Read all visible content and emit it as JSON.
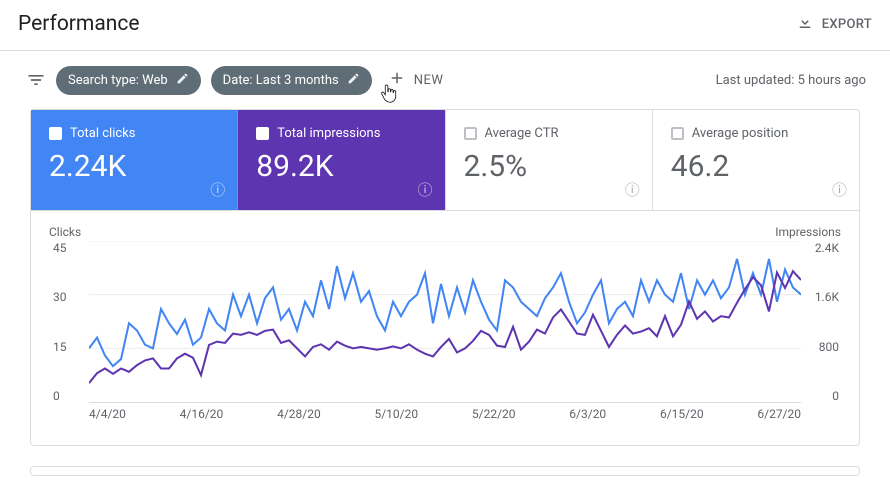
{
  "header": {
    "title": "Performance",
    "export_label": "EXPORT"
  },
  "filters": {
    "chips": [
      {
        "label": "Search type: Web"
      },
      {
        "label": "Date: Last 3 months"
      }
    ],
    "new_label": "NEW",
    "last_updated": "Last updated: 5 hours ago"
  },
  "metrics": [
    {
      "key": "total_clicks",
      "label": "Total clicks",
      "value": "2.24K",
      "checked": true,
      "variant": "blue"
    },
    {
      "key": "total_impressions",
      "label": "Total impressions",
      "value": "89.2K",
      "checked": true,
      "variant": "purple"
    },
    {
      "key": "avg_ctr",
      "label": "Average CTR",
      "value": "2.5%",
      "checked": false,
      "variant": "plain"
    },
    {
      "key": "avg_position",
      "label": "Average position",
      "value": "46.2",
      "checked": false,
      "variant": "plain"
    }
  ],
  "chart_data": {
    "type": "line",
    "left_axis_label": "Clicks",
    "right_axis_label": "Impressions",
    "left_ylim": [
      0,
      45
    ],
    "right_ylim": [
      0,
      2400
    ],
    "y_left_ticks": [
      "45",
      "30",
      "15",
      "0"
    ],
    "y_right_ticks": [
      "2.4K",
      "1.6K",
      "800",
      "0"
    ],
    "x_ticks": [
      "4/4/20",
      "4/16/20",
      "4/28/20",
      "5/10/20",
      "5/22/20",
      "6/3/20",
      "6/15/20",
      "6/27/20"
    ],
    "series": [
      {
        "name": "Clicks",
        "axis": "left",
        "color": "#4285f4",
        "values": [
          15,
          18,
          13,
          10,
          12,
          22,
          20,
          16,
          15,
          26,
          22,
          19,
          23,
          16,
          18,
          26,
          22,
          20,
          30,
          24,
          30,
          22,
          29,
          32,
          23,
          26,
          20,
          28,
          24,
          34,
          26,
          38,
          29,
          36,
          28,
          31,
          24,
          20,
          28,
          24,
          28,
          30,
          36,
          22,
          33,
          24,
          32,
          25,
          34,
          28,
          23,
          20,
          34,
          32,
          28,
          26,
          24,
          29,
          32,
          36,
          28,
          22,
          25,
          30,
          34,
          22,
          26,
          28,
          24,
          34,
          28,
          34,
          30,
          28,
          36,
          26,
          34,
          30,
          34,
          29,
          32,
          40,
          30,
          36,
          30,
          40,
          28,
          37,
          32,
          30
        ]
      },
      {
        "name": "Impressions",
        "axis": "right",
        "color": "#5e35b1",
        "values": [
          280,
          430,
          500,
          420,
          500,
          450,
          550,
          620,
          650,
          500,
          500,
          650,
          720,
          660,
          400,
          850,
          900,
          880,
          1020,
          1000,
          1040,
          1000,
          1060,
          1080,
          880,
          920,
          800,
          680,
          820,
          860,
          780,
          900,
          840,
          800,
          820,
          800,
          780,
          800,
          830,
          800,
          860,
          780,
          720,
          680,
          820,
          940,
          740,
          800,
          910,
          1060,
          1000,
          840,
          820,
          1120,
          780,
          900,
          1080,
          1020,
          1260,
          1380,
          1200,
          1020,
          1000,
          1300,
          1060,
          820,
          1000,
          1140,
          1020,
          1050,
          1100,
          980,
          1280,
          980,
          1150,
          1500,
          1240,
          1350,
          1200,
          1280,
          1260,
          1480,
          1680,
          1860,
          1740,
          1350,
          1930,
          1700,
          1950,
          1820
        ]
      }
    ]
  }
}
